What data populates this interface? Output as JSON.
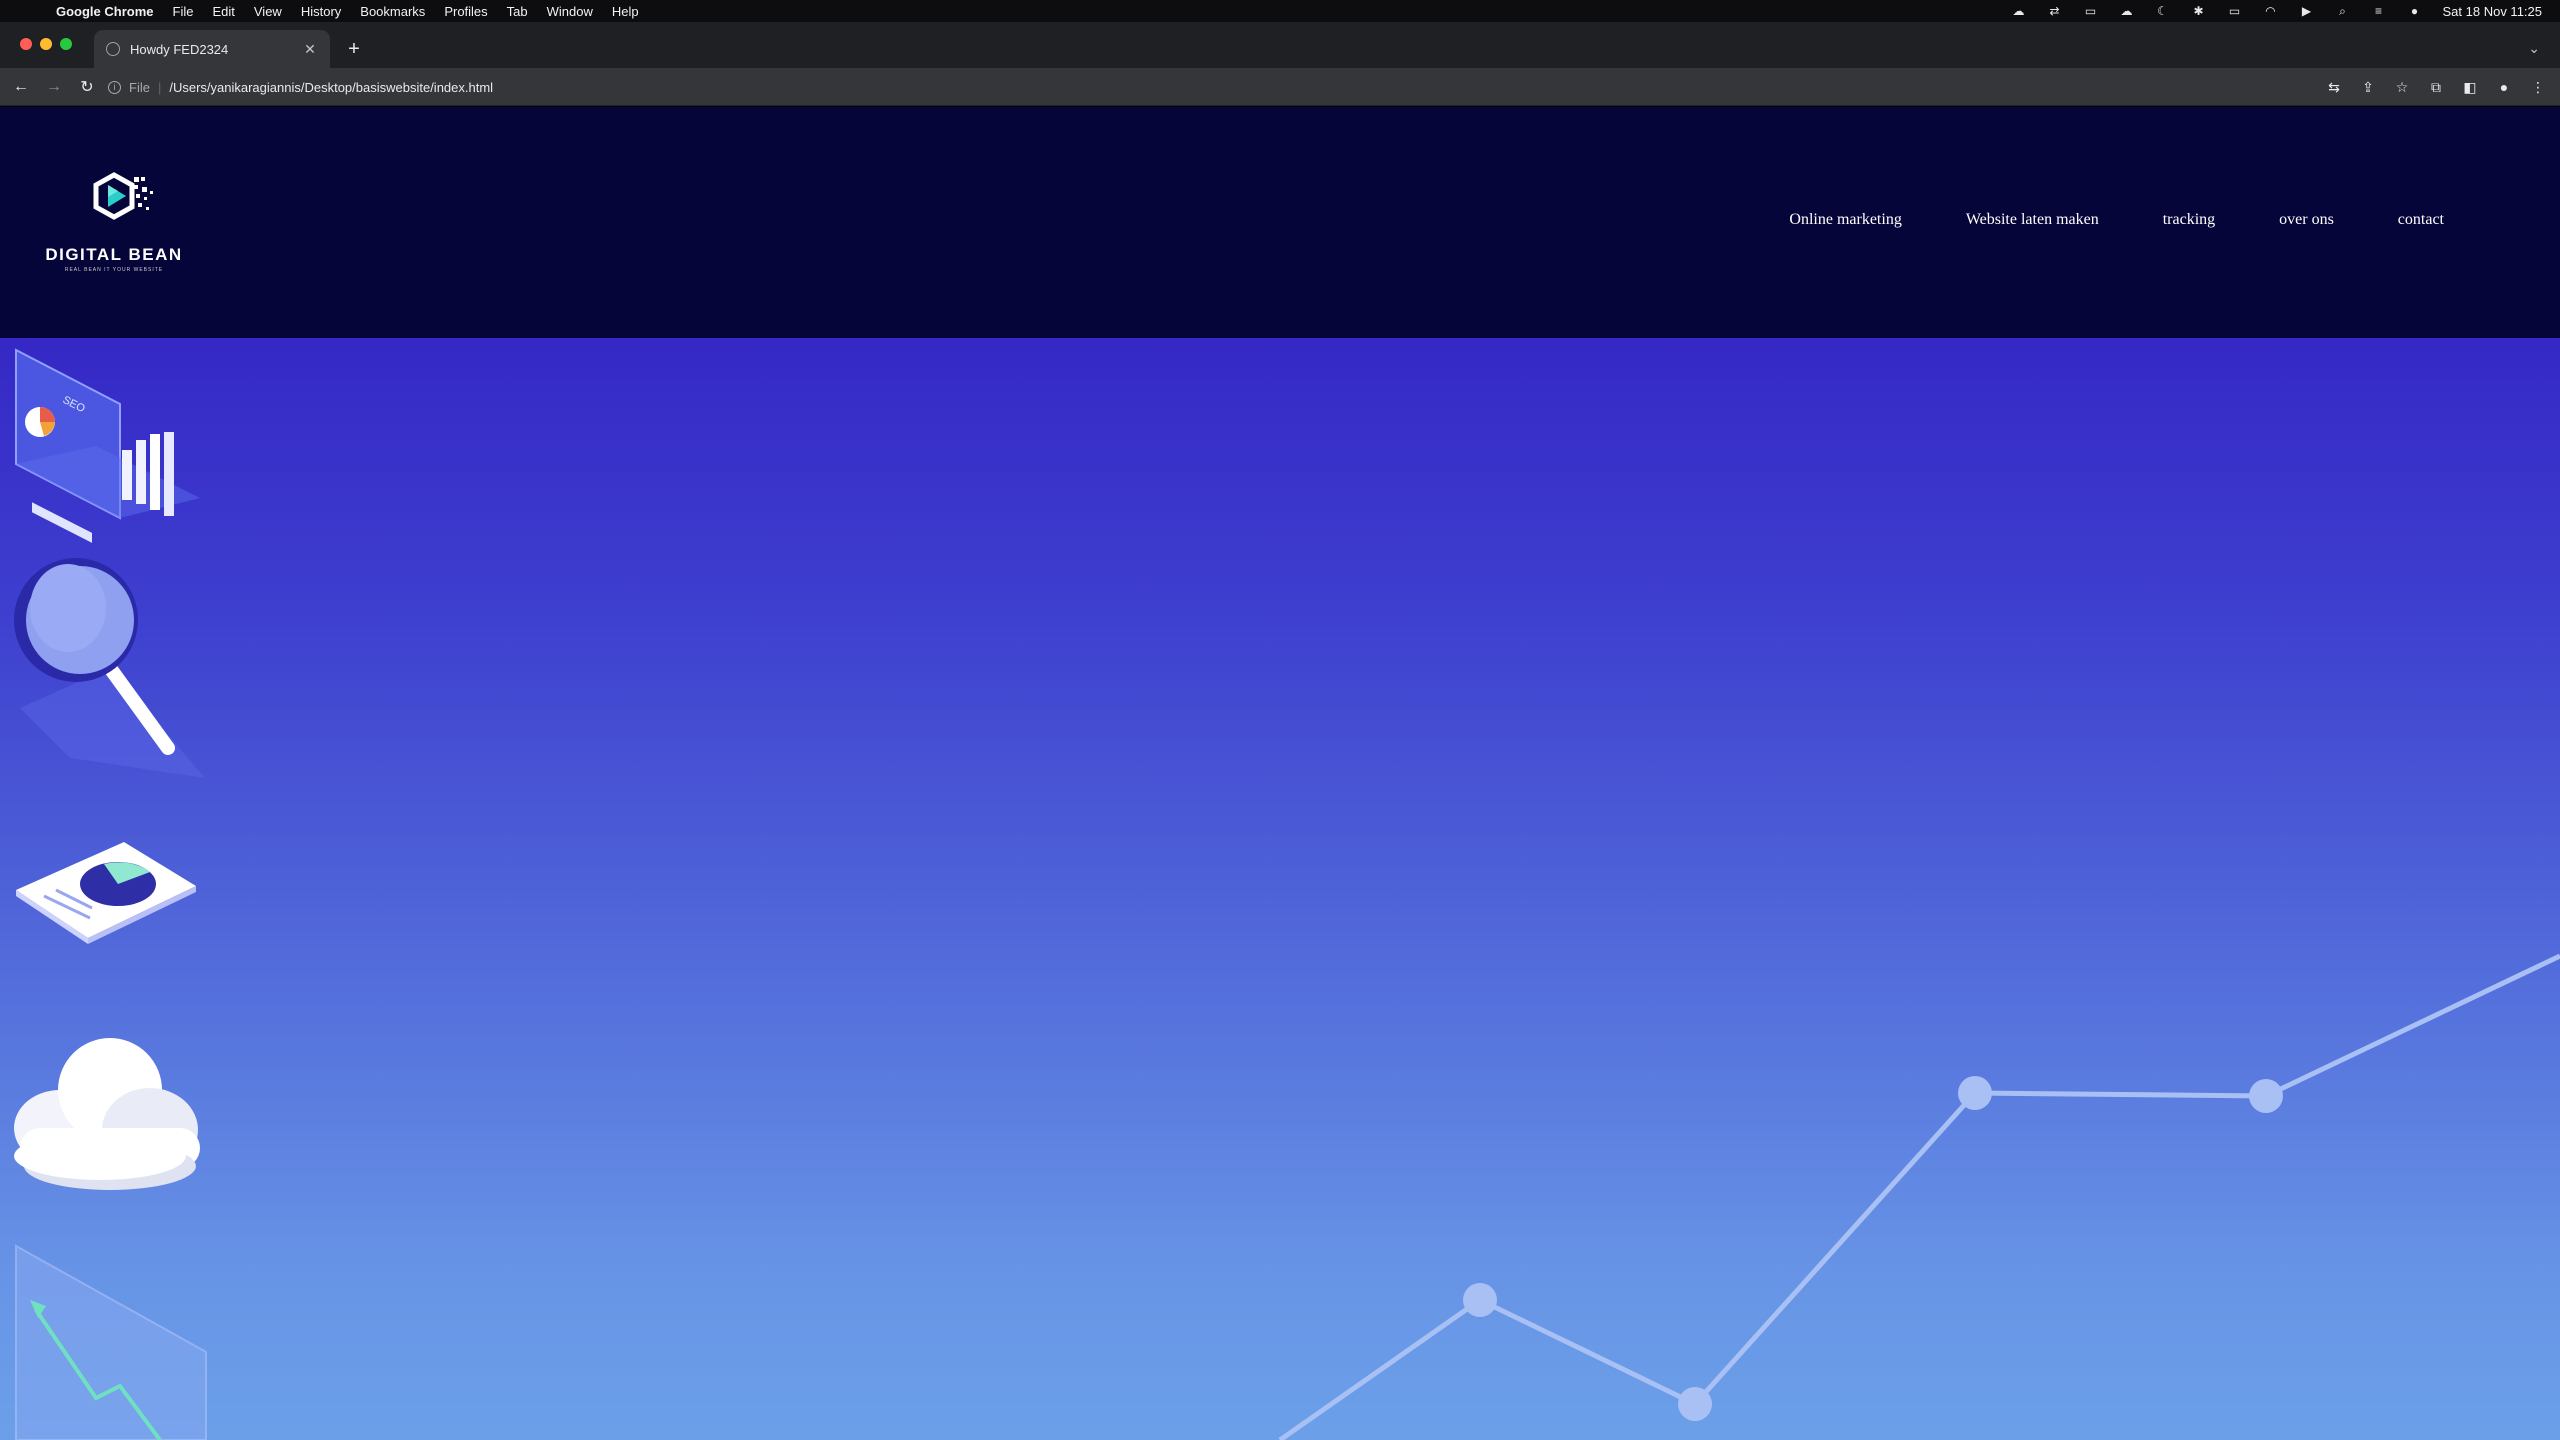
{
  "menubar": {
    "app_name": "Google Chrome",
    "items": [
      "File",
      "Edit",
      "View",
      "History",
      "Bookmarks",
      "Profiles",
      "Tab",
      "Window",
      "Help"
    ],
    "clock": "Sat 18 Nov  11:25"
  },
  "browser": {
    "tab_title": "Howdy FED2324",
    "url_scheme": "File",
    "url": "/Users/yanikaragiannis/Desktop/basiswebsite/index.html"
  },
  "site": {
    "logo_text": "DIGITAL BEAN",
    "logo_tagline": "REAL BEAN IT YOUR WEBSITE",
    "nav": [
      "Online marketing",
      "Website laten maken",
      "tracking",
      "over ons",
      "contact"
    ]
  },
  "colors": {
    "header_bg": "#05053a",
    "hero_top": "#3528c6",
    "hero_bottom": "#6ba0e8",
    "chart_line": "#a9c0f5"
  },
  "icons": {
    "side_icons": [
      "seo-monitor-icon",
      "magnifier-icon",
      "report-document-icon",
      "cloud-icon",
      "growth-chart-icon"
    ]
  }
}
